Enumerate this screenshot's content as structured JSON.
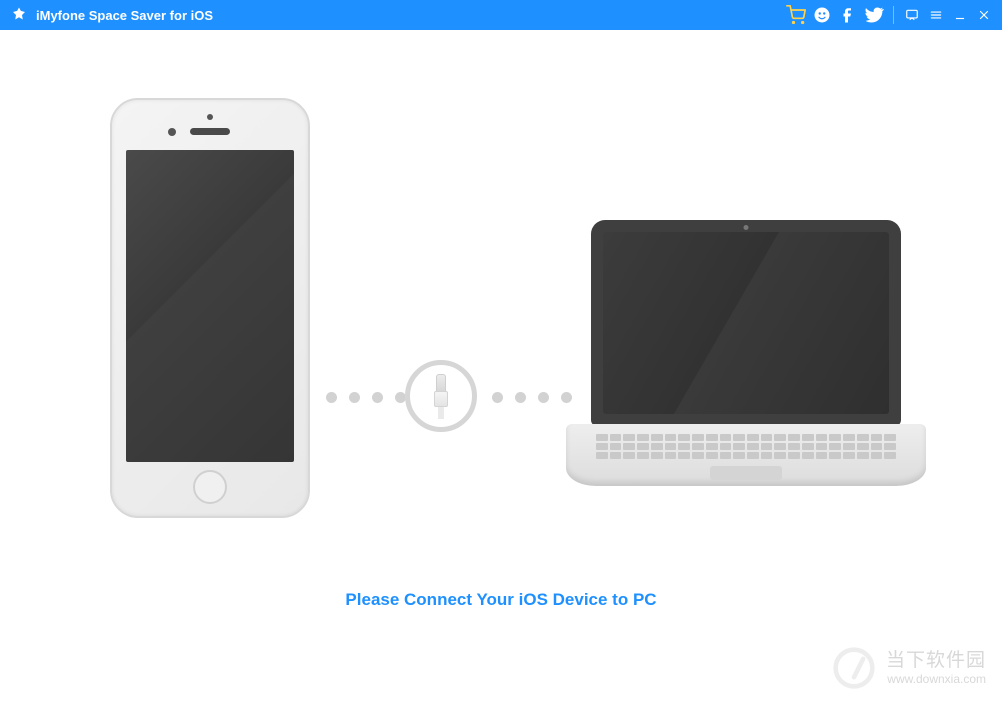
{
  "titlebar": {
    "app_title": "iMyfone Space Saver for iOS"
  },
  "main": {
    "prompt": "Please Connect Your iOS Device to PC"
  },
  "watermark": {
    "line1": "当下软件园",
    "line2": "www.downxia.com"
  }
}
